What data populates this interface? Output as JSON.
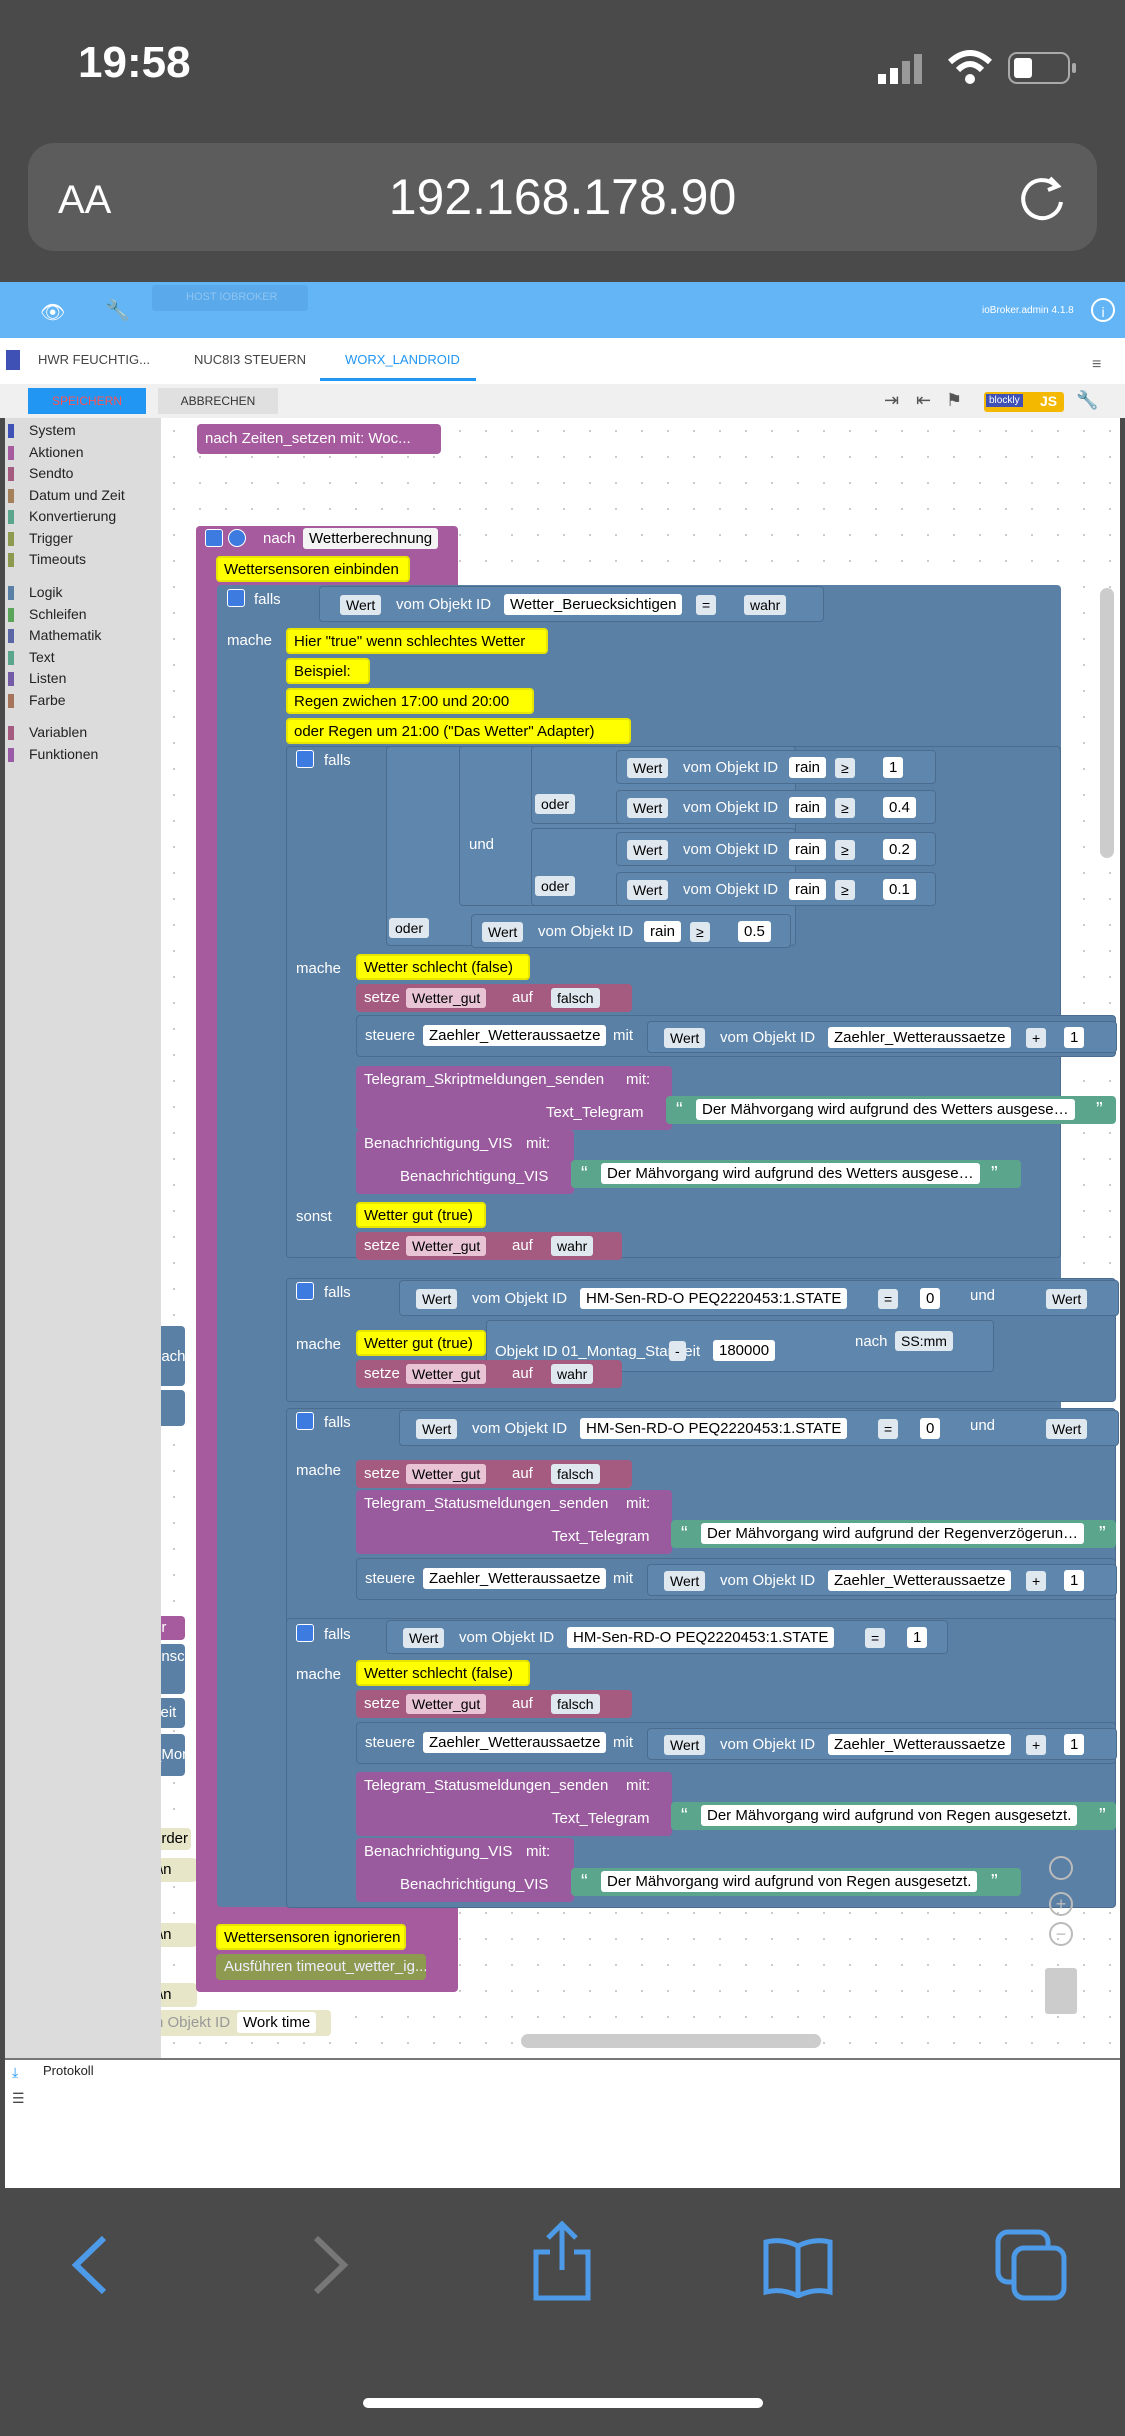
{
  "status": {
    "time": "19:58"
  },
  "browser": {
    "aa": "AA",
    "url": "192.168.178.90"
  },
  "header": {
    "host": "HOST IOBROKER",
    "version": "ioBroker.admin 4.1.8"
  },
  "tabs": [
    "HWR FEUCHTIG...",
    "NUC8I3 STEUERN",
    "WORX_LANDROID"
  ],
  "toolbar": {
    "save": "SPEICHERN",
    "cancel": "ABBRECHEN",
    "blockly": "blockly",
    "js": "JS"
  },
  "categories": [
    {
      "label": "System",
      "color": "#3f51b5"
    },
    {
      "label": "Aktionen",
      "color": "#a55b9e"
    },
    {
      "label": "Sendto",
      "color": "#a55b80"
    },
    {
      "label": "Datum und Zeit",
      "color": "#a5805b"
    },
    {
      "label": "Konvertierung",
      "color": "#5ba58c"
    },
    {
      "label": "Trigger",
      "color": "#8d9a4f"
    },
    {
      "label": "Timeouts",
      "color": "#8d9a4f"
    },
    {
      "label": "Logik",
      "color": "#5b80a5"
    },
    {
      "label": "Schleifen",
      "color": "#5ba55b"
    },
    {
      "label": "Mathematik",
      "color": "#5b67a5"
    },
    {
      "label": "Text",
      "color": "#5ba58c"
    },
    {
      "label": "Listen",
      "color": "#745ba5"
    },
    {
      "label": "Farbe",
      "color": "#a5745b"
    },
    {
      "label": "Variablen",
      "color": "#a55b80"
    },
    {
      "label": "Funktionen",
      "color": "#995ba5"
    }
  ],
  "blocks": {
    "top_call": "nach Zeiten_setzen mit: Woc...",
    "func_nach": "nach",
    "func_name": "Wetterberechnung",
    "comment1": "Wettersensoren einbinden",
    "falls": "falls",
    "mache": "mache",
    "sonst": "sonst",
    "wert": "Wert",
    "vom_objekt": "vom Objekt ID",
    "obj_berueck": "Wetter_Beruecksichtigen",
    "eq": "=",
    "ge": "≥",
    "wahr": "wahr",
    "falsch": "falsch",
    "c_true": "Hier \"true\" wenn schlechtes Wetter",
    "c_beispiel": "Beispiel:",
    "c_regen": "Regen zwichen 17:00 und 20:00",
    "c_oder": "oder Regen um 21:00 (\"Das Wetter\" Adapter)",
    "oder": "oder",
    "und": "und",
    "rain": "rain",
    "v1": "1",
    "v04": "0.4",
    "v02": "0.2",
    "v01": "0.1",
    "v05": "0.5",
    "c_schlecht": "Wetter schlecht (false)",
    "c_gut": "Wetter gut (true)",
    "setze": "setze",
    "var_gut": "Wetter_gut",
    "auf": "auf",
    "steuere": "steuere",
    "obj_zaehler": "Zaehler_Wetteraussaetze",
    "mit": "mit",
    "plus": "+",
    "tg_skript": "Telegram_Skriptmeldungen_senden",
    "tg_status": "Telegram_Statusmeldungen_senden",
    "mit_colon": "mit:",
    "text_tg": "Text_Telegram",
    "msg_wetter": "Der Mähvorgang wird aufgrund des Wetters ausgese…",
    "benach": "Benachrichtigung_VIS",
    "msg_wetter2": "Der Mähvorgang wird aufgrund des Wetters ausgese…",
    "obj_hm": "HM-Sen-RD-O PEQ2220453:1.STATE",
    "v0": "0",
    "obj_montag": "Objekt ID  01_Montag_Startzeit",
    "minus": "-",
    "v180000": "180000",
    "nach": "nach",
    "ssmm": "SS:mm",
    "msg_regenverz": "Der Mähvorgang wird aufgrund der Regenverzögerun…",
    "msg_regen": "Der Mähvorgang wird aufgrund von Regen ausgesetzt.",
    "c_ignor": "Wettersensoren ignorieren",
    "ausfuehren": "Ausführen timeout_wetter_ig...",
    "worktime_obj": "n Objekt ID",
    "worktime": "Work time",
    "left_nach": "nach",
    "left_n": "\\n",
    "left_zeit": "zeit",
    "left_mon": "_Mon",
    "left_urder": "urder",
    "left_ensch": "ensch",
    "left_er": "er"
  },
  "protokoll": {
    "label": "Protokoll"
  }
}
